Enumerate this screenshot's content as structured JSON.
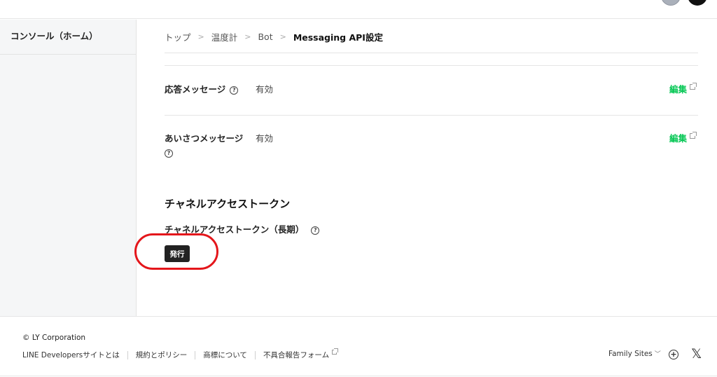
{
  "sidebar": {
    "items": [
      {
        "label": "コンソール（ホーム）"
      }
    ]
  },
  "breadcrumb": {
    "items": [
      "トップ",
      "温度計",
      "Bot"
    ],
    "current": "Messaging API設定",
    "separator": ">"
  },
  "settings": {
    "auto_reply": {
      "label": "応答メッセージ",
      "value": "有効",
      "edit_label": "編集"
    },
    "greeting": {
      "label_line1": "あいさつメッセージ",
      "value": "有効",
      "edit_label": "編集"
    }
  },
  "token_section": {
    "title": "チャネルアクセストークン",
    "long_term_label": "チャネルアクセストークン（長期）",
    "issue_button_label": "発行"
  },
  "footer": {
    "copyright": "© LY Corporation",
    "links": [
      "LINE Developersサイトとは",
      "規約とポリシー",
      "商標について",
      "不具合報告フォーム"
    ],
    "family_sites": "Family Sites",
    "chevron": "﹀",
    "x_glyph": "𝕏"
  },
  "icons": {
    "help": "?",
    "plus": "+"
  },
  "colors": {
    "accent_green": "#06c755",
    "highlight_red": "#e4161b",
    "button_dark": "#222222"
  }
}
